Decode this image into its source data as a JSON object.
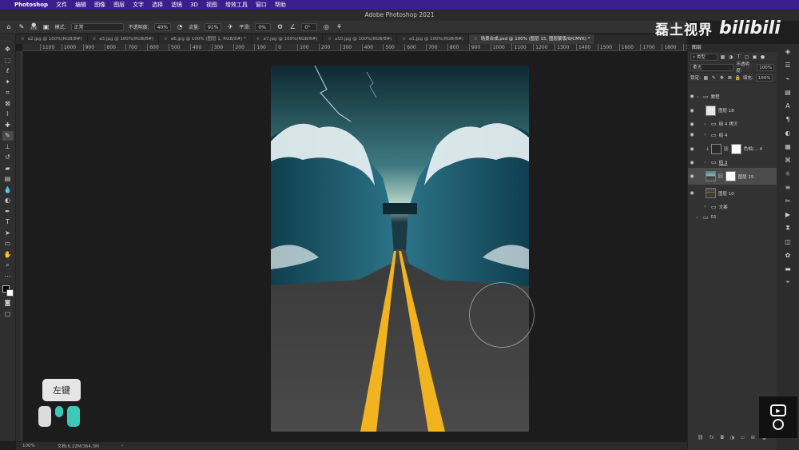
{
  "menubar": {
    "apple": "",
    "items": [
      "Photoshop",
      "文件",
      "编辑",
      "图像",
      "图层",
      "文字",
      "选择",
      "滤镜",
      "3D",
      "视图",
      "增效工具",
      "窗口",
      "帮助"
    ]
  },
  "window": {
    "title": "Adobe Photoshop 2021"
  },
  "watermark": {
    "text": "磊土视界",
    "logo": "bilibili"
  },
  "options": {
    "brush_size": "400",
    "mode_label": "模式:",
    "mode_value": "正常",
    "opacity_label": "不透明度:",
    "opacity_value": "40%",
    "flow_label": "流量:",
    "flow_value": "91%",
    "smoothing_label": "平滑:",
    "smoothing_value": "0%",
    "angle_value": "0°"
  },
  "tabs": [
    {
      "label": "a2.jpg @ 100%(RGB/8#)",
      "active": false
    },
    {
      "label": "a3.jpg @ 100%(RGB/8#)",
      "active": false
    },
    {
      "label": "a6.jpg @ 100% (图层 1, RGB/8#) *",
      "active": false
    },
    {
      "label": "a7.jpg @ 100%(RGB/8#)",
      "active": false
    },
    {
      "label": "a10.jpg @ 100%(RGB/8#)",
      "active": false
    },
    {
      "label": "a1.jpg @ 100%(RGB/8#)",
      "active": false
    },
    {
      "label": "场景合成.psd @ 100% (图层 15, 图层蒙版/8/CMYK) *",
      "active": true
    }
  ],
  "ruler": [
    "1100",
    "1000",
    "900",
    "800",
    "700",
    "600",
    "500",
    "400",
    "300",
    "200",
    "100",
    "0",
    "100",
    "200",
    "300",
    "400",
    "500",
    "600",
    "700",
    "800",
    "900",
    "1000",
    "1100",
    "1200",
    "1300",
    "1400",
    "1500",
    "1600",
    "1700",
    "1800",
    "1900"
  ],
  "status": {
    "zoom": "100%",
    "doc": "文档:6.22M/364.3M",
    "arrow": "›"
  },
  "key_hint": {
    "label": "左键"
  },
  "layers_panel": {
    "title": "图层",
    "filter_label": "类型",
    "blend_mode": "柔光",
    "opacity_label": "不透明度:",
    "opacity_value": "100%",
    "lock_label": "锁定:",
    "fill_label": "填充:",
    "fill_value": "100%",
    "layers": [
      {
        "name": "教程",
        "kind": "group-open"
      },
      {
        "name": "图层 18",
        "kind": "pixel"
      },
      {
        "name": "组 4 拷贝",
        "kind": "group"
      },
      {
        "name": "组 4",
        "kind": "group"
      },
      {
        "name": "色相/... 4",
        "kind": "adjustment"
      },
      {
        "name": "组 3",
        "kind": "group"
      },
      {
        "name": "图层 15",
        "kind": "masked",
        "selected": true
      },
      {
        "name": "图层 10",
        "kind": "image"
      },
      {
        "name": "文案",
        "kind": "group-hidden"
      },
      {
        "name": "01",
        "kind": "group-root"
      }
    ]
  },
  "colors": {
    "menubar": "#3a1e8c",
    "road_yellow": "#f2b321",
    "water": "#1f5a6b"
  }
}
